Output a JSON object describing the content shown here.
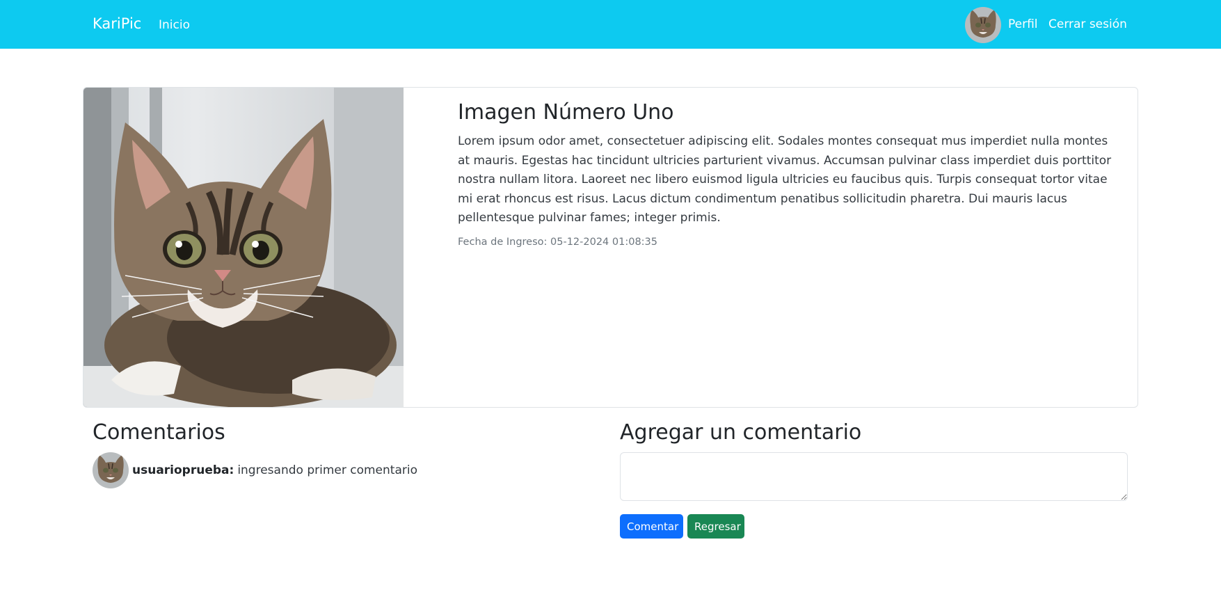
{
  "navbar": {
    "brand": "KariPic",
    "inicio": "Inicio",
    "perfil": "Perfil",
    "logout": "Cerrar sesión",
    "avatar_icon": "cat-avatar"
  },
  "image": {
    "title": "Imagen Número Uno",
    "description": "Lorem ipsum odor amet, consectetuer adipiscing elit. Sodales montes consequat mus imperdiet nulla montes at mauris. Egestas hac tincidunt ultricies parturient vivamus. Accumsan pulvinar class imperdiet duis porttitor nostra nullam litora. Laoreet nec libero euismod ligula ultricies eu faucibus quis. Turpis consequat tortor vitae mi erat rhoncus est risus. Lacus dictum condimentum penatibus sollicitudin pharetra. Dui mauris lacus pellentesque pulvinar fames; integer primis.",
    "date": "Fecha de Ingreso: 05-12-2024 01:08:35",
    "picture": "tabby-kitten-photo"
  },
  "comments": {
    "heading": "Comentarios",
    "items": [
      {
        "user": "usuarioprueba:",
        "text": "ingresando primer comentario",
        "avatar_icon": "cat-avatar"
      }
    ]
  },
  "add_comment": {
    "heading": "Agregar un comentario",
    "value": "",
    "submit_label": "Comentar",
    "back_label": "Regresar"
  },
  "colors": {
    "navbar": "#0dcaf0",
    "primary": "#0d6efd",
    "success": "#198754"
  }
}
